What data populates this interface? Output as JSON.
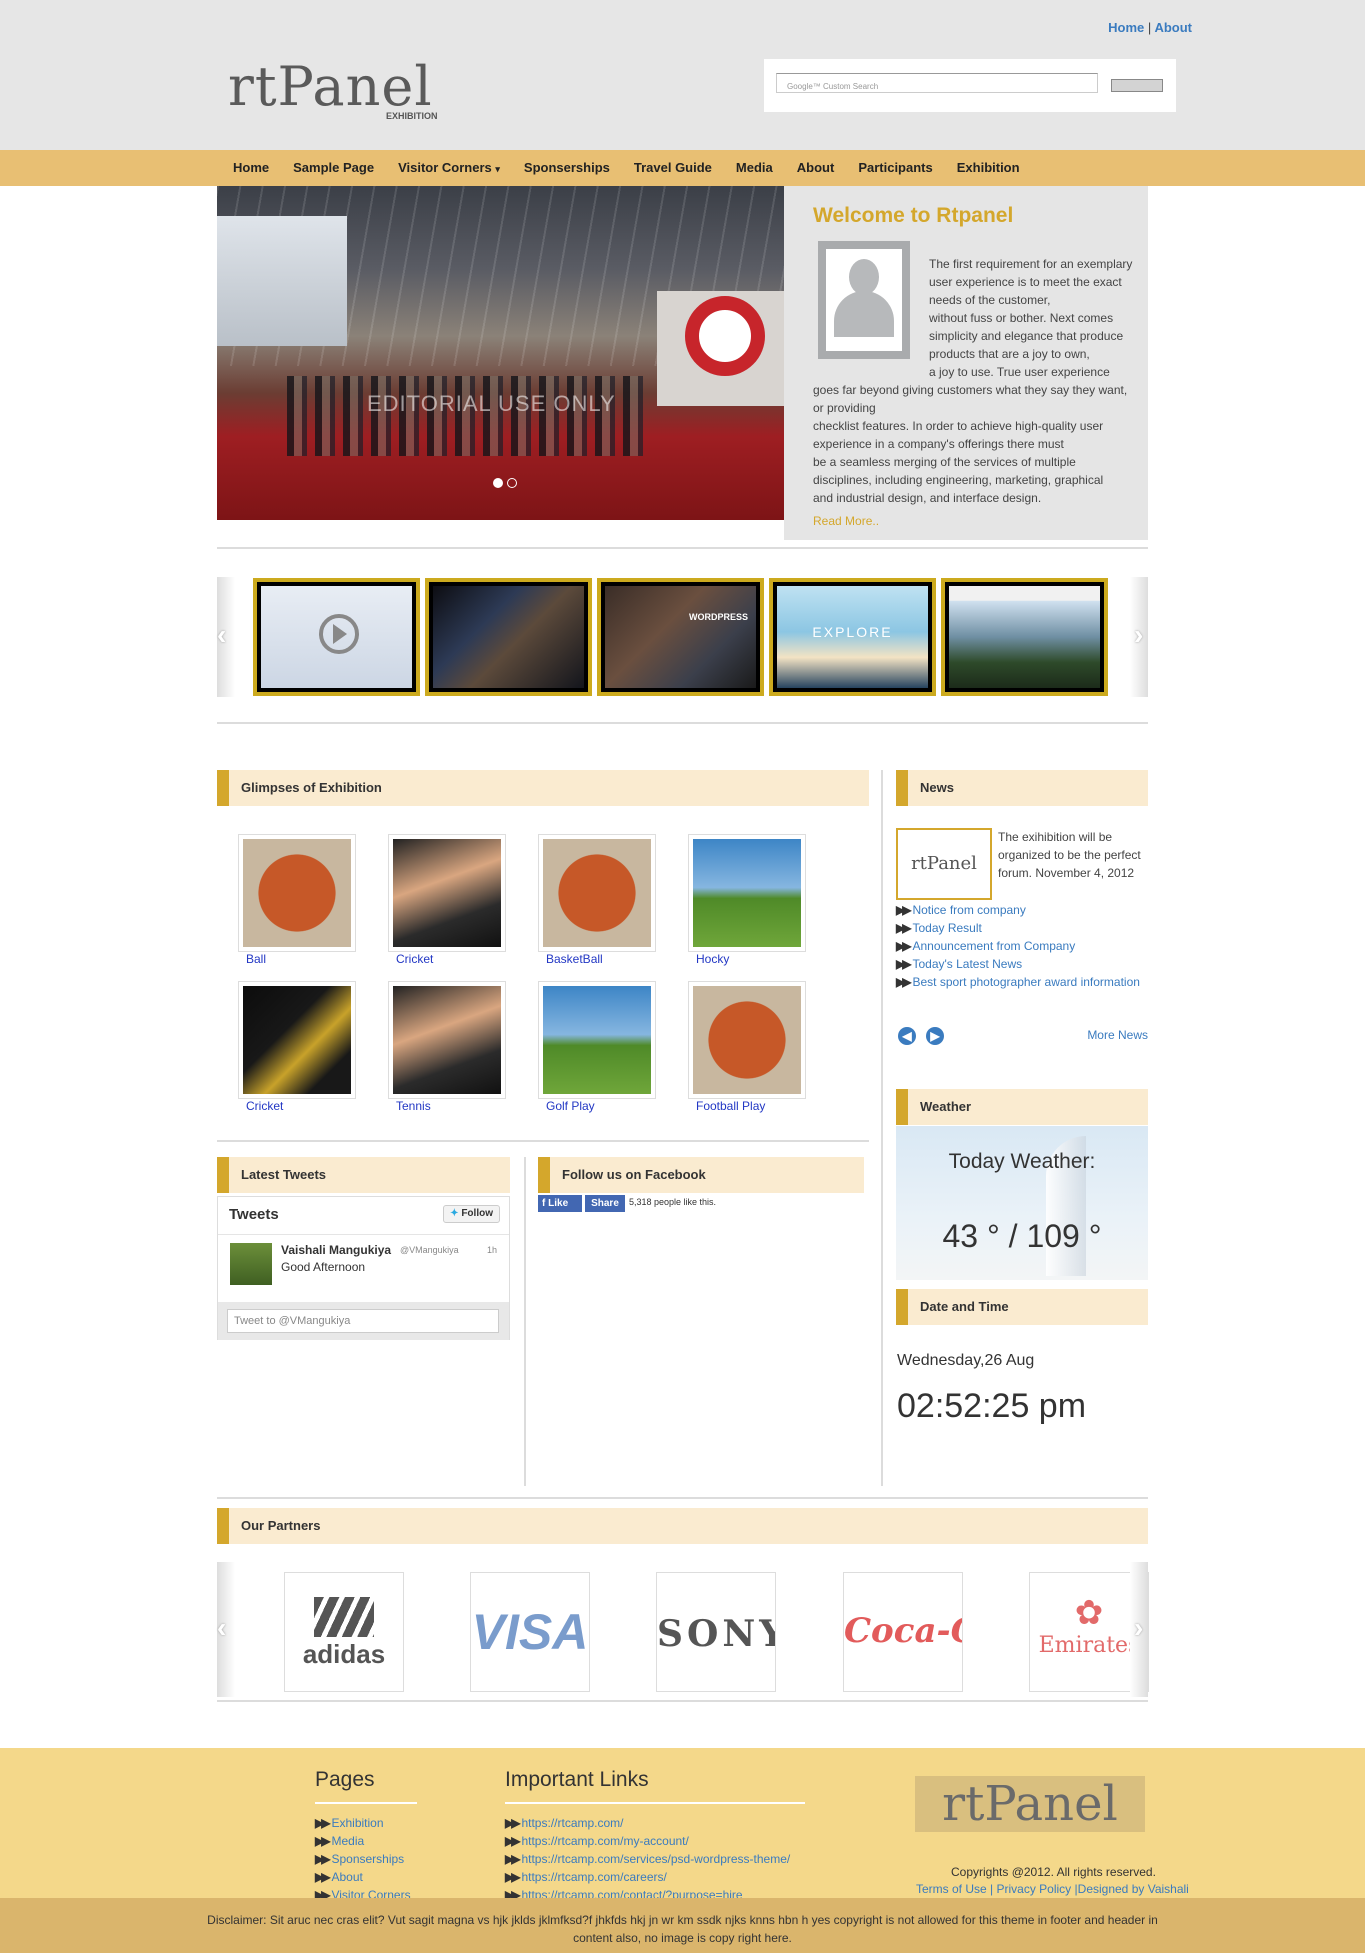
{
  "header": {
    "top_links": [
      "Home",
      "About"
    ],
    "top_links_sep": "|",
    "logo_text": "rtPanel",
    "logo_sub": "EXHIBITION",
    "search_placeholder": "Google™ Custom Search"
  },
  "nav": {
    "items": [
      "Home",
      "Sample Page",
      "Visitor Corners",
      "Sponserships",
      "Travel Guide",
      "Media",
      "About",
      "Participants",
      "Exhibition"
    ],
    "dropdown_indicator": "▾"
  },
  "hero": {
    "watermark": "EDITORIAL USE ONLY",
    "welcome_title": "Welcome to Rtpanel",
    "welcome_lines_indented": [
      "The first requirement for an exemplary",
      "user experience is to meet the exact",
      "needs of the customer,",
      "without fuss or bother. Next comes",
      "simplicity and elegance that produce",
      "products that are a joy to own,",
      "a joy to use. True user experience"
    ],
    "welcome_lines_full": [
      "goes far beyond giving customers what they say they want,",
      "or providing",
      "checklist features. In order to achieve high-quality user",
      "experience in a company's offerings there must",
      "be a seamless merging of the services of multiple",
      "disciplines, including engineering, marketing, graphical",
      "and industrial design, and interface design."
    ],
    "read_more": "Read More.."
  },
  "videos": {
    "thumb_texts": [
      "",
      "",
      "WORDPRESS",
      "EXPLORE",
      ""
    ]
  },
  "glimpses": {
    "title": "Glimpses of Exhibition",
    "items": [
      "Ball",
      "Cricket",
      "BasketBall",
      "Hocky",
      "Cricket",
      "Tennis",
      "Golf Play",
      "Football Play"
    ]
  },
  "news": {
    "title": "News",
    "logo_text": "rtPanel",
    "intro": "The exihibition will be organized to be the perfect forum. November 4, 2012",
    "items": [
      "Notice from company",
      "Today Result",
      "Announcement from Company",
      "Today's Latest News",
      "Best sport photographer award information"
    ],
    "more": "More News",
    "prev": "◀",
    "next": "▶"
  },
  "weather": {
    "title": "Weather",
    "label": "Today Weather:",
    "temps": "43 ° / 109 °"
  },
  "datetime": {
    "title": "Date and Time",
    "date": "Wednesday,26 Aug",
    "time": "02:52:25 pm"
  },
  "tweets": {
    "title": "Latest Tweets",
    "widget_title": "Tweets",
    "follow": "Follow",
    "user_name": "Vaishali Mangukiya",
    "user_handle": "@VMangukiya",
    "age": "1h",
    "text": "Good Afternoon",
    "tweet_placeholder": "Tweet to @VMangukiya"
  },
  "facebook": {
    "title": "Follow us on Facebook",
    "like": "Like",
    "share": "Share",
    "count_text": "5,318 people like this."
  },
  "partners": {
    "title": "Our Partners",
    "items": [
      "adidas",
      "VISA",
      "SONY",
      "Coca-Cola",
      "Emirates"
    ]
  },
  "footer": {
    "pages_title": "Pages",
    "pages": [
      "Exhibition",
      "Media",
      "Sponserships",
      "About",
      "Visitor Corners"
    ],
    "links_title": "Important Links",
    "links": [
      "https://rtcamp.com/",
      "https://rtcamp.com/my-account/",
      "https://rtcamp.com/services/psd-wordpress-theme/",
      "https://rtcamp.com/careers/",
      "https://rtcamp.com/contact/?purpose=hire"
    ],
    "logo_text": "rtPanel",
    "copyright": "Copyrights @2012. All rights reserved.",
    "terms": "Terms of Use",
    "privacy": "Privacy Policy",
    "designed": "Designed by Vaishali",
    "disclaimer": "Disclaimer: Sit aruc nec cras elit? Vut sagit magna vs hjk jklds jklmfksd?f jhkfds hkj jn wr km ssdk njks knns hbn h yes copyright is not allowed for this theme in footer and header in content also, no image is copy right here."
  },
  "colors": {
    "accent": "#d4a72c",
    "nav_bg": "#e8bf73",
    "footer_bg": "#f4d88a",
    "link": "#3a7bbf"
  }
}
